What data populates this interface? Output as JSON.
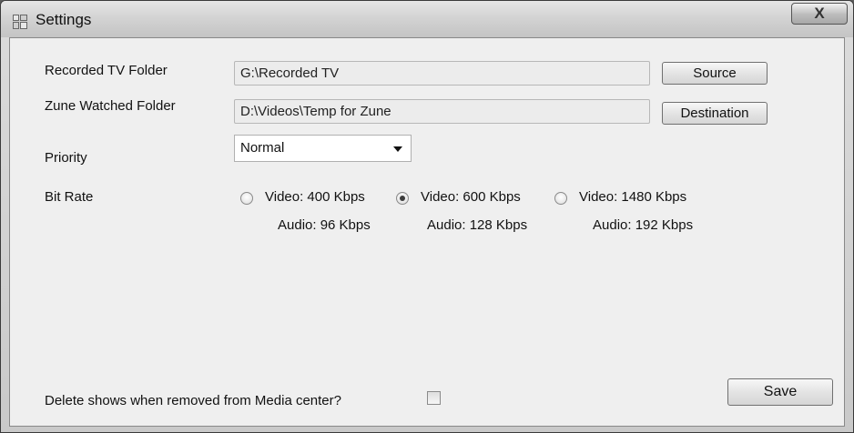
{
  "window": {
    "title": "Settings",
    "close_label": "X"
  },
  "fields": {
    "recorded_tv": {
      "label": "Recorded TV Folder",
      "value": "G:\\Recorded TV",
      "button": "Source"
    },
    "zune_watched": {
      "label": "Zune Watched Folder",
      "value": "D:\\Videos\\Temp for Zune",
      "button": "Destination"
    }
  },
  "priority": {
    "label": "Priority",
    "selected": "Normal"
  },
  "bitrate": {
    "label": "Bit Rate",
    "options": [
      {
        "video": "Video: 400 Kbps",
        "audio": "Audio: 96 Kbps",
        "checked": false
      },
      {
        "video": "Video: 600 Kbps",
        "audio": "Audio: 128 Kbps",
        "checked": true
      },
      {
        "video": "Video: 1480 Kbps",
        "audio": "Audio: 192 Kbps",
        "checked": false
      }
    ]
  },
  "delete_option": {
    "label": "Delete shows when removed from Media center?",
    "checked": false
  },
  "save_label": "Save"
}
